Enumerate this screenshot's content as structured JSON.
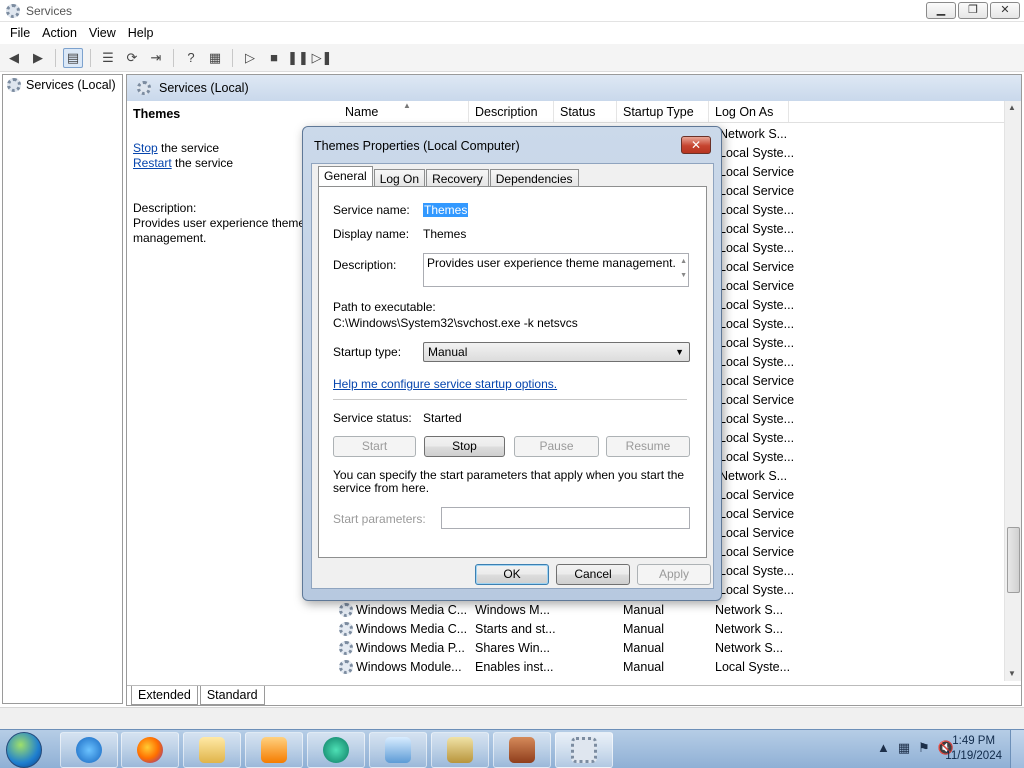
{
  "window": {
    "title": "Services",
    "min_glyph": "▁",
    "max_glyph": "❐",
    "close_glyph": "✕"
  },
  "menu": [
    "File",
    "Action",
    "View",
    "Help"
  ],
  "tree": {
    "root_label": "Services (Local)"
  },
  "header": {
    "title": "Services (Local)"
  },
  "description_pane": {
    "service_title": "Themes",
    "stop_link": "Stop",
    "stop_suffix": " the service",
    "restart_link": "Restart",
    "restart_suffix": " the service",
    "description_label": "Description:",
    "description_text": "Provides user experience theme management."
  },
  "columns": [
    "Name",
    "Description",
    "Status",
    "Startup Type",
    "Log On As"
  ],
  "logon_visible_behind_dialog": [
    "Network S...",
    "Local Syste...",
    "Local Service",
    "Local Service",
    "Local Syste...",
    "Local Syste...",
    "Local Syste...",
    "Local Service",
    "Local Service",
    "Local Syste...",
    "Local Syste...",
    "Local Syste...",
    "Local Syste...",
    "Local Service",
    "Local Service",
    "Local Syste...",
    "Local Syste...",
    "Local Syste...",
    "Network S...",
    "Local Service",
    "Local Service",
    "Local Service",
    "Local Service",
    "Local Syste...",
    "Local Syste..."
  ],
  "rows": [
    {
      "name": "Windows Media C...",
      "description": "Windows M...",
      "status": "",
      "startup": "Manual",
      "logon": "Network S..."
    },
    {
      "name": "Windows Media C...",
      "description": "Starts and st...",
      "status": "",
      "startup": "Manual",
      "logon": "Network S..."
    },
    {
      "name": "Windows Media P...",
      "description": "Shares Win...",
      "status": "",
      "startup": "Manual",
      "logon": "Network S..."
    },
    {
      "name": "Windows Module...",
      "description": "Enables inst...",
      "status": "",
      "startup": "Manual",
      "logon": "Local Syste..."
    }
  ],
  "bottom_tabs": [
    "Extended",
    "Standard"
  ],
  "dialog": {
    "title": "Themes Properties (Local Computer)",
    "close_glyph": "✕",
    "tabs": [
      "General",
      "Log On",
      "Recovery",
      "Dependencies"
    ],
    "service_name_label": "Service name:",
    "service_name_value": "Themes",
    "display_name_label": "Display name:",
    "display_name_value": "Themes",
    "description_label": "Description:",
    "description_value": "Provides user experience theme management.",
    "path_label": "Path to executable:",
    "path_value": "C:\\Windows\\System32\\svchost.exe -k netsvcs",
    "startup_type_label": "Startup type:",
    "startup_type_value": "Manual",
    "help_link": "Help me configure service startup options.",
    "status_label": "Service status:",
    "status_value": "Started",
    "start_button": "Start",
    "stop_button": "Stop",
    "pause_button": "Pause",
    "resume_button": "Resume",
    "params_note": "You can specify the start parameters that apply when you start the service from here.",
    "params_label": "Start parameters:",
    "params_value": "",
    "ok_button": "OK",
    "cancel_button": "Cancel",
    "apply_button": "Apply"
  },
  "taskbar": {
    "apps": [
      "internet-explorer",
      "firefox",
      "file-explorer",
      "media-player",
      "app-5",
      "control-panel",
      "keys-app",
      "firewall-app",
      "services-app"
    ],
    "time": "1:49 PM",
    "date": "11/19/2024"
  },
  "colors": {
    "accent": "#3399ff",
    "link": "#0645ad",
    "close_red": "#c6442f"
  }
}
